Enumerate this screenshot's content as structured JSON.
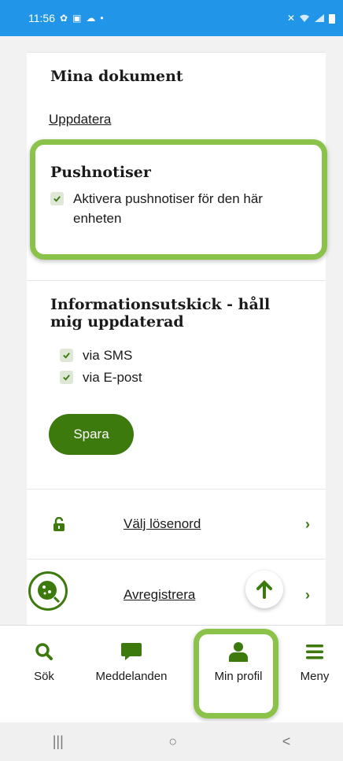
{
  "status_bar": {
    "time": "11:56",
    "left_icons": [
      "gear-icon",
      "calendar-icon",
      "cloud-icon"
    ],
    "dot": "•"
  },
  "documents": {
    "title": "Mina dokument",
    "update_link": "Uppdatera"
  },
  "push": {
    "title": "Pushnotiser",
    "option_label": "Aktivera pushnotiser för den här enheten",
    "checked": true
  },
  "info": {
    "title": "Informationsutskick - håll mig uppdaterad",
    "options": [
      {
        "label": "via SMS",
        "checked": true
      },
      {
        "label": "via E-post",
        "checked": true
      }
    ],
    "save_label": "Spara"
  },
  "menu": {
    "items": [
      {
        "label": "Välj lösenord",
        "icon": "unlock-icon"
      },
      {
        "label": "Avregistrera",
        "icon": "cookie-icon"
      }
    ]
  },
  "bottom_nav": {
    "items": [
      {
        "label": "Sök",
        "icon": "search-icon"
      },
      {
        "label": "Meddelanden",
        "icon": "chat-icon"
      },
      {
        "label": "Min profil",
        "icon": "user-icon",
        "active": true
      },
      {
        "label": "Meny",
        "icon": "hamburger-icon"
      }
    ]
  },
  "system_nav": {
    "recents": "|||",
    "home": "○",
    "back": "<"
  },
  "colors": {
    "accent": "#3d7a0e",
    "highlight": "#8bc34a",
    "status_bar": "#2196e8"
  }
}
